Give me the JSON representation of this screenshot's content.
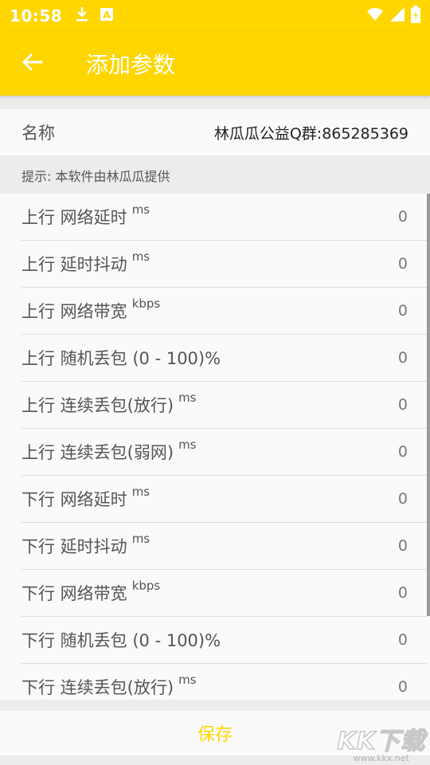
{
  "status": {
    "time": "10:58",
    "icons": [
      "download-icon",
      "a-notification-icon",
      "wifi-icon",
      "signal-icon",
      "battery-charging-icon"
    ]
  },
  "appbar": {
    "title": "添加参数",
    "back_icon": "arrow-left-icon"
  },
  "name_row": {
    "label": "名称",
    "value": "林瓜瓜公益Q群:865285369"
  },
  "hint": "提示: 本软件由林瓜瓜提供",
  "params": [
    {
      "label": "上行 网络延时",
      "unit": "ms",
      "value": "0"
    },
    {
      "label": "上行 延时抖动",
      "unit": "ms",
      "value": "0"
    },
    {
      "label": "上行 网络带宽",
      "unit": "kbps",
      "value": "0"
    },
    {
      "label": "上行 随机丢包 (0 - 100)%",
      "unit": "",
      "value": "0"
    },
    {
      "label": "上行 连续丢包(放行)",
      "unit": "ms",
      "value": "0"
    },
    {
      "label": "上行 连续丢包(弱网)",
      "unit": "ms",
      "value": "0"
    },
    {
      "label": "下行 网络延时",
      "unit": "ms",
      "value": "0"
    },
    {
      "label": "下行 延时抖动",
      "unit": "ms",
      "value": "0"
    },
    {
      "label": "下行 网络带宽",
      "unit": "kbps",
      "value": "0"
    },
    {
      "label": "下行 随机丢包 (0 - 100)%",
      "unit": "",
      "value": "0"
    },
    {
      "label": "下行 连续丢包(放行)",
      "unit": "ms",
      "value": "0"
    }
  ],
  "save_label": "保存",
  "watermark": {
    "logo": "KK下载",
    "url": "www.kkx.net"
  },
  "colors": {
    "accent": "#ffd600",
    "background": "#ececec",
    "surface": "#fafafa"
  }
}
